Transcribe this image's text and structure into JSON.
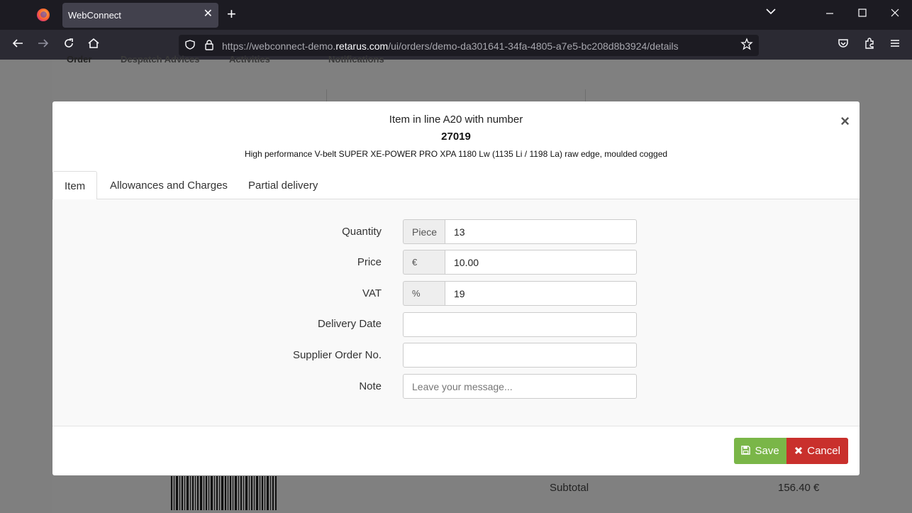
{
  "browser": {
    "tab_title": "WebConnect",
    "tab_close": "✕",
    "new_tab": "+",
    "url_prefix": "https://webconnect-demo.",
    "url_domain": "retarus.com",
    "url_path": "/ui/orders/demo-da301641-34fa-4805-a7e5-bc208d8b3924/details"
  },
  "background": {
    "tabs": [
      "Order",
      "Despatch Advices",
      "Activities",
      "Notifications"
    ],
    "subtotal_label": "Subtotal",
    "subtotal_value": "156.40 €"
  },
  "modal": {
    "title": "Item in line A20 with number",
    "number": "27019",
    "description": "High performance V-belt SUPER XE-POWER PRO XPA 1180 Lw (1135 Li / 1198 La) raw edge, moulded cogged",
    "close": "×",
    "tabs": [
      "Item",
      "Allowances and Charges",
      "Partial delivery"
    ],
    "fields": {
      "quantity": {
        "label": "Quantity",
        "addon": "Piece",
        "value": "13"
      },
      "price": {
        "label": "Price",
        "addon": "€",
        "value": "10.00"
      },
      "vat": {
        "label": "VAT",
        "addon": "%",
        "value": "19"
      },
      "delivery_date": {
        "label": "Delivery Date",
        "value": ""
      },
      "supplier_order": {
        "label": "Supplier Order No.",
        "value": ""
      },
      "note": {
        "label": "Note",
        "value": "",
        "placeholder": "Leave your message..."
      }
    },
    "save_label": "Save",
    "cancel_label": "Cancel"
  },
  "colors": {
    "save": "#7ab648",
    "cancel": "#c9302c",
    "browser_bar": "#1c1b22"
  }
}
